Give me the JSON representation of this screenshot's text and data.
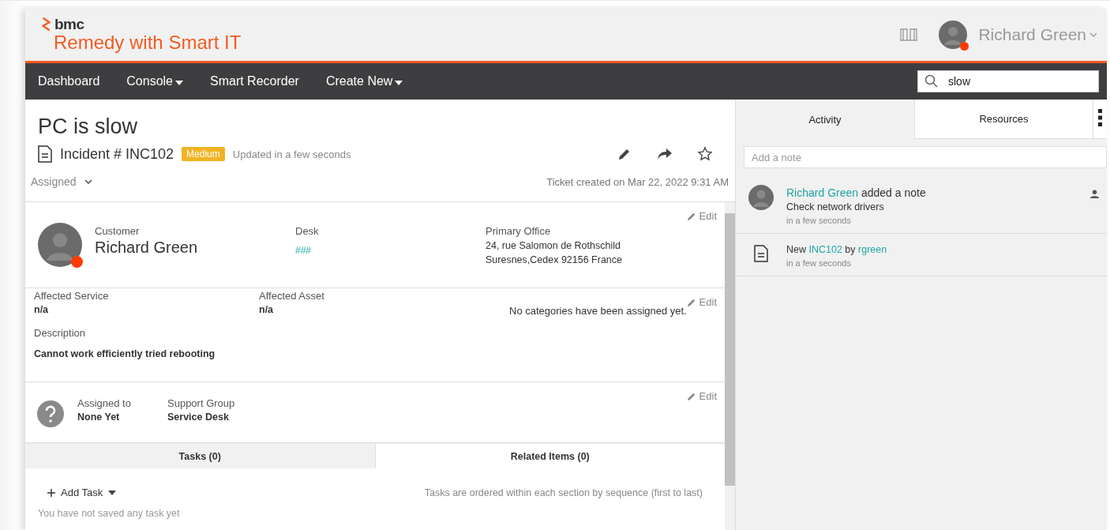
{
  "header": {
    "brand": "bmc",
    "product": "Remedy with Smart IT",
    "user": {
      "name": "Richard Green",
      "online": true
    }
  },
  "nav": {
    "items": [
      {
        "label": "Dashboard",
        "dropdown": false
      },
      {
        "label": "Console",
        "dropdown": true
      },
      {
        "label": "Smart Recorder",
        "dropdown": false
      },
      {
        "label": "Create New",
        "dropdown": true
      }
    ],
    "search": {
      "value": "slow"
    }
  },
  "ticket": {
    "title": "PC is slow",
    "number": "Incident # INC102",
    "priority": "Medium",
    "updated": "Updated in a few seconds",
    "status": "Assigned",
    "created": "Ticket created on Mar 22, 2022 9:31 AM"
  },
  "customer": {
    "label": "Customer",
    "name": "Richard Green",
    "online": true,
    "desk_label": "Desk",
    "desk": "###",
    "office_label": "Primary Office",
    "office_lines": [
      "24, rue Salomon de Rothschild",
      "Suresnes,Cedex 92156 France"
    ],
    "edit": "Edit"
  },
  "details": {
    "service_label": "Affected Service",
    "service": "n/a",
    "asset_label": "Affected Asset",
    "asset": "n/a",
    "categories": "No categories have been assigned yet.",
    "description_label": "Description",
    "description": "Cannot work efficiently tried rebooting",
    "edit": "Edit"
  },
  "assignment": {
    "assigned_label": "Assigned to",
    "assigned": "None Yet",
    "group_label": "Support Group",
    "group": "Service Desk",
    "edit": "Edit"
  },
  "tabs": [
    {
      "label": "Tasks (0)",
      "selected": true
    },
    {
      "label": "Related Items (0)",
      "selected": false
    }
  ],
  "tasks": {
    "add": "Add Task",
    "hint": "Tasks are ordered within each section by sequence (first to last)",
    "empty": "You have not saved any task yet"
  },
  "side_tabs": [
    {
      "label": "Activity",
      "selected": true
    },
    {
      "label": "Resources",
      "selected": false
    }
  ],
  "note": {
    "placeholder": "Add a note"
  },
  "activity": [
    {
      "kind": "note",
      "author": "Richard Green",
      "action": "added a note",
      "text": "Check network drivers",
      "time": "in a few seconds"
    },
    {
      "kind": "created",
      "prefix": "New",
      "link": "INC102",
      "by": "by",
      "user": "rgreen",
      "time": "in a few seconds"
    }
  ]
}
